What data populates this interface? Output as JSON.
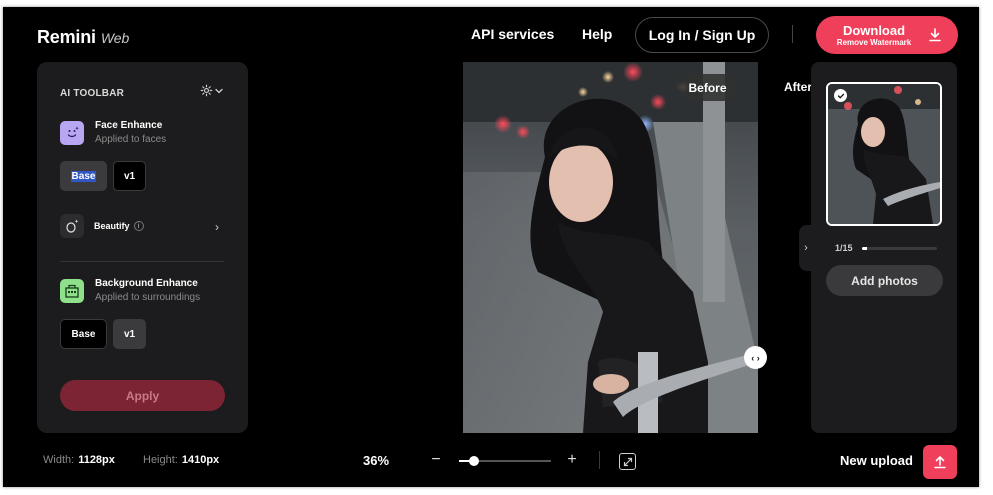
{
  "header": {
    "logo_main": "Remini",
    "logo_sub": "Web",
    "nav": {
      "api": "API services",
      "help": "Help",
      "login": "Log In / Sign Up"
    },
    "download": {
      "title": "Download",
      "subtitle": "Remove Watermark"
    }
  },
  "toolbar": {
    "title": "AI TOOLBAR",
    "face": {
      "title": "Face Enhance",
      "subtitle": "Applied to faces",
      "options": [
        "Base",
        "v1"
      ],
      "selected": "Base"
    },
    "beautify": {
      "label": "Beautify",
      "info": "i"
    },
    "background": {
      "title": "Background Enhance",
      "subtitle": "Applied to surroundings",
      "options": [
        "Base",
        "v1"
      ],
      "selected": "v1"
    },
    "apply_label": "Apply"
  },
  "canvas": {
    "before_label": "Before",
    "after_label": "After"
  },
  "thumbnails": {
    "counter": "1/15",
    "progress": 0.07,
    "add_label": "Add photos"
  },
  "footer": {
    "width_label": "Width:",
    "width_value": "1128px",
    "height_label": "Height:",
    "height_value": "1410px",
    "zoom": "36%",
    "zoom_level": 0.16,
    "new_upload": "New upload"
  },
  "colors": {
    "accent": "#ef3f5a",
    "panel": "#1c1c1e",
    "background": "#000000",
    "apply_disabled": "#7c2434"
  },
  "icons": [
    "download-icon",
    "gear-icon",
    "chevron-down-icon",
    "face-icon",
    "beautify-icon",
    "info-icon",
    "chevron-right-icon",
    "background-icon",
    "check-icon",
    "split-handle-icon",
    "zoom-out-icon",
    "zoom-in-icon",
    "fit-screen-icon",
    "upload-icon"
  ]
}
